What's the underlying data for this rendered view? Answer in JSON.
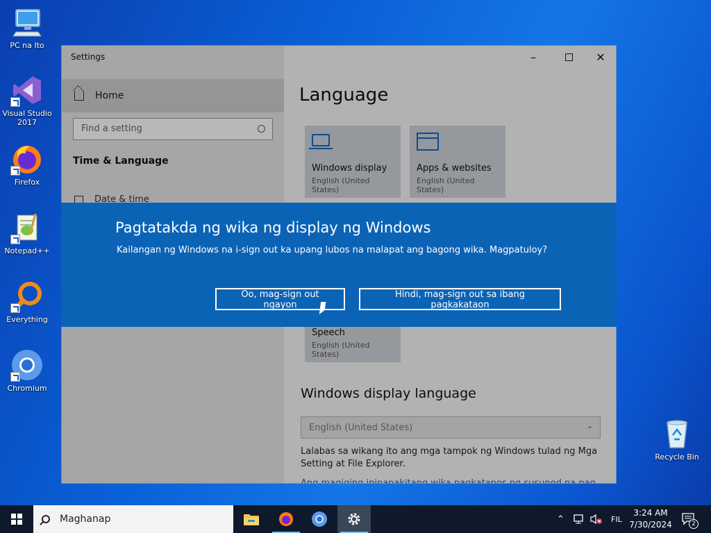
{
  "desktop": {
    "icons": [
      {
        "label": "PC na Ito"
      },
      {
        "label": "Visual Studio 2017"
      },
      {
        "label": "Firefox"
      },
      {
        "label": "Notepad++"
      },
      {
        "label": "Everything"
      },
      {
        "label": "Chromium"
      },
      {
        "label": "Recycle Bin"
      }
    ]
  },
  "window": {
    "title": "Settings",
    "nav": {
      "home_label": "Home",
      "search_placeholder": "Find a setting",
      "section_title": "Time & Language",
      "items": [
        {
          "label": "Date & time"
        }
      ]
    },
    "main": {
      "page_title": "Language",
      "tiles": [
        {
          "name": "Windows display",
          "sub": "English (United States)"
        },
        {
          "name": "Apps & websites",
          "sub": "English (United States)"
        },
        {
          "name": "Speech",
          "sub": "English (United States)"
        }
      ],
      "display_language_heading": "Windows display language",
      "display_language_value": "English (United States)",
      "description": "Lalabas sa wikang ito ang mga tampok ng Windows tulad ng Mga Setting at File Explorer.",
      "description2": "Ang magiging ipinapakitang wika pagkatapos ng susunod na pag"
    }
  },
  "dialog": {
    "title": "Pagtatakda ng wika ng display ng Windows",
    "message": "Kailangan ng Windows na i-sign out ka upang lubos na malapat ang bagong wika. Magpatuloy?",
    "confirm_label": "Oo, mag-sign out ngayon",
    "cancel_label": "Hindi, mag-sign out sa ibang pagkakataon"
  },
  "taskbar": {
    "search_placeholder": "Maghanap",
    "language": "FIL",
    "time": "3:24 AM",
    "date": "7/30/2024",
    "notification_count": "2"
  },
  "colors": {
    "dialog_bg": "#0b63b6",
    "accent": "#1769c8",
    "taskbar_bg": "#0e1a2b"
  }
}
